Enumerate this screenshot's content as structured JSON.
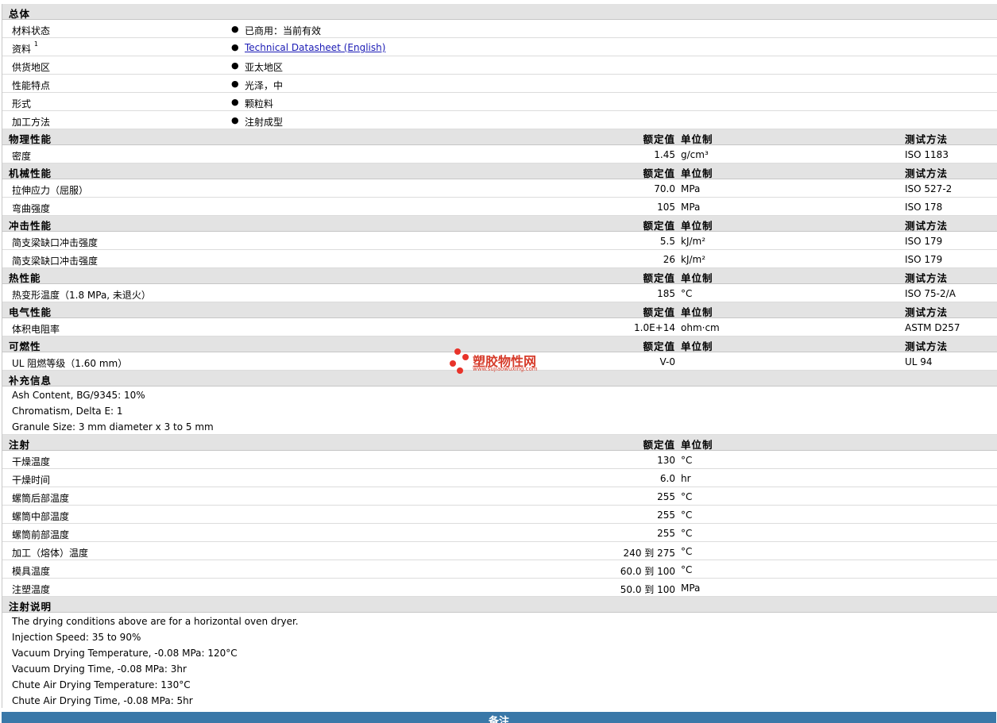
{
  "general": {
    "title": "总体",
    "rows": [
      {
        "label": "材料状态",
        "value": "已商用：当前有效"
      },
      {
        "label": "资料",
        "sup": "1",
        "value": "Technical Datasheet (English)"
      },
      {
        "label": "供货地区",
        "value": "亚太地区"
      },
      {
        "label": "性能特点",
        "value": "光泽，中"
      },
      {
        "label": "形式",
        "value": "颗粒料"
      },
      {
        "label": "加工方法",
        "value": "注射成型"
      }
    ]
  },
  "column_labels": {
    "nominal": "额定值",
    "unit": "单位制",
    "test": "测试方法"
  },
  "physical": {
    "title": "物理性能",
    "rows": [
      {
        "name": "密度",
        "value": "1.45",
        "unit": "g/cm³",
        "test": "ISO 1183"
      }
    ]
  },
  "mechanical": {
    "title": "机械性能",
    "rows": [
      {
        "name": "拉伸应力（屈服）",
        "value": "70.0",
        "unit": "MPa",
        "test": "ISO 527-2"
      },
      {
        "name": "弯曲强度",
        "value": "105",
        "unit": "MPa",
        "test": "ISO 178"
      }
    ]
  },
  "impact": {
    "title": "冲击性能",
    "rows": [
      {
        "name": "简支梁缺口冲击强度",
        "value": "5.5",
        "unit": "kJ/m²",
        "test": "ISO 179"
      },
      {
        "name": "简支梁缺口冲击强度",
        "value": "26",
        "unit": "kJ/m²",
        "test": "ISO 179"
      }
    ]
  },
  "thermal": {
    "title": "热性能",
    "rows": [
      {
        "name": "热变形温度（1.8 MPa, 未退火）",
        "value": "185",
        "unit": "°C",
        "test": "ISO 75-2/A"
      }
    ]
  },
  "electrical": {
    "title": "电气性能",
    "rows": [
      {
        "name": "体积电阻率",
        "value": "1.0E+14",
        "unit": "ohm·cm",
        "test": "ASTM D257"
      }
    ]
  },
  "flammability": {
    "title": "可燃性",
    "rows": [
      {
        "name": "UL 阻燃等级（1.60 mm）",
        "value": "V-0",
        "unit": "",
        "test": "UL 94"
      }
    ]
  },
  "supplemental": {
    "title": "补充信息",
    "notes": [
      "Ash Content, BG/9345: 10%",
      "Chromatism, Delta E: 1",
      "Granule Size: 3 mm diameter x 3 to 5 mm"
    ]
  },
  "injection": {
    "title": "注射",
    "rows": [
      {
        "name": "干燥温度",
        "value": "130",
        "unit": "°C"
      },
      {
        "name": "干燥时间",
        "value": "6.0",
        "unit": "hr"
      },
      {
        "name": "螺筒后部温度",
        "value": "255",
        "unit": "°C"
      },
      {
        "name": "螺筒中部温度",
        "value": "255",
        "unit": "°C"
      },
      {
        "name": "螺筒前部温度",
        "value": "255",
        "unit": "°C"
      },
      {
        "name": "加工（熔体）温度",
        "value": "240 到  275",
        "unit": "°C"
      },
      {
        "name": "模具温度",
        "value": "60.0 到  100",
        "unit": "°C"
      },
      {
        "name": "注塑温度",
        "value": "50.0 到  100",
        "unit": "MPa"
      }
    ]
  },
  "injection_notes": {
    "title": "注射说明",
    "notes": [
      "The drying conditions above are for a horizontal oven dryer.",
      "Injection Speed: 35 to 90%",
      "Vacuum Drying Temperature, -0.08 MPa: 120°C",
      "Vacuum Drying Time, -0.08 MPa: 3hr",
      "Chute Air Drying Temperature: 130°C",
      "Chute Air Drying Time, -0.08 MPa: 5hr"
    ]
  },
  "footer": {
    "label": "备注"
  },
  "watermark": {
    "text": "塑胶物性网",
    "url": "www.sujiaowuxing.com"
  },
  "colors": {
    "header_bg": "#e3e3e3",
    "footer_bar": "#3a78a8",
    "link": "#1b1bb5",
    "watermark": "#d63b2a"
  }
}
